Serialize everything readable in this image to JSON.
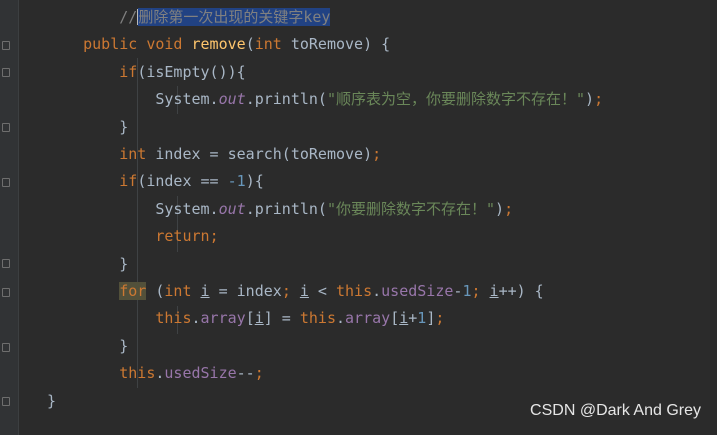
{
  "editor": {
    "lines": [
      {
        "indent": "        ",
        "parts": [
          {
            "t": "//",
            "c": "cmt"
          },
          {
            "t": "删除第一次出现的关键字key",
            "c": "cmt sel",
            "caret": true
          }
        ]
      },
      {
        "indent": "    ",
        "parts": [
          {
            "t": "public ",
            "c": "k"
          },
          {
            "t": "void ",
            "c": "k"
          },
          {
            "t": "remove",
            "c": "fn"
          },
          {
            "t": "("
          },
          {
            "t": "int ",
            "c": "k"
          },
          {
            "t": "toRemove) {"
          }
        ]
      },
      {
        "indent": "        ",
        "parts": [
          {
            "t": "if",
            "c": "k"
          },
          {
            "t": "(isEmpty()){"
          }
        ]
      },
      {
        "indent": "            ",
        "parts": [
          {
            "t": "System."
          },
          {
            "t": "out",
            "c": "fldi"
          },
          {
            "t": ".println("
          },
          {
            "t": "\"顺序表为空，你要删除数字不存在！\"",
            "c": "str"
          },
          {
            "t": ")"
          },
          {
            "t": ";",
            "c": "k"
          }
        ]
      },
      {
        "indent": "        ",
        "parts": [
          {
            "t": "}"
          }
        ]
      },
      {
        "indent": "        ",
        "parts": [
          {
            "t": "int ",
            "c": "k"
          },
          {
            "t": "index = search(toRemove)"
          },
          {
            "t": ";",
            "c": "k"
          }
        ]
      },
      {
        "indent": "        ",
        "parts": [
          {
            "t": "if",
            "c": "k"
          },
          {
            "t": "(index == "
          },
          {
            "t": "-1",
            "c": "num"
          },
          {
            "t": "){"
          }
        ]
      },
      {
        "indent": "            ",
        "parts": [
          {
            "t": "System."
          },
          {
            "t": "out",
            "c": "fldi"
          },
          {
            "t": ".println("
          },
          {
            "t": "\"你要删除数字不存在！\"",
            "c": "str"
          },
          {
            "t": ")"
          },
          {
            "t": ";",
            "c": "k"
          }
        ]
      },
      {
        "indent": "            ",
        "parts": [
          {
            "t": "return",
            "c": "k"
          },
          {
            "t": ";",
            "c": "k"
          }
        ]
      },
      {
        "indent": "        ",
        "parts": [
          {
            "t": "}"
          }
        ]
      },
      {
        "indent": "        ",
        "parts": [
          {
            "t": "for",
            "c": "k hl"
          },
          {
            "t": " ("
          },
          {
            "t": "int ",
            "c": "k"
          },
          {
            "t": "i",
            "c": "u"
          },
          {
            "t": " = index"
          },
          {
            "t": "; ",
            "c": "k"
          },
          {
            "t": "i",
            "c": "u"
          },
          {
            "t": " < "
          },
          {
            "t": "this",
            "c": "k"
          },
          {
            "t": "."
          },
          {
            "t": "usedSize",
            "c": "fld"
          },
          {
            "t": "-"
          },
          {
            "t": "1",
            "c": "num"
          },
          {
            "t": "; ",
            "c": "k"
          },
          {
            "t": "i",
            "c": "u"
          },
          {
            "t": "++) {"
          }
        ]
      },
      {
        "indent": "            ",
        "parts": [
          {
            "t": "this",
            "c": "k"
          },
          {
            "t": "."
          },
          {
            "t": "array",
            "c": "fld"
          },
          {
            "t": "["
          },
          {
            "t": "i",
            "c": "u"
          },
          {
            "t": "] = "
          },
          {
            "t": "this",
            "c": "k"
          },
          {
            "t": "."
          },
          {
            "t": "array",
            "c": "fld"
          },
          {
            "t": "["
          },
          {
            "t": "i",
            "c": "u"
          },
          {
            "t": "+"
          },
          {
            "t": "1",
            "c": "num"
          },
          {
            "t": "]"
          },
          {
            "t": ";",
            "c": "k"
          }
        ]
      },
      {
        "indent": "        ",
        "parts": [
          {
            "t": "}"
          }
        ]
      },
      {
        "indent": "        ",
        "parts": [
          {
            "t": "this",
            "c": "k"
          },
          {
            "t": "."
          },
          {
            "t": "usedSize",
            "c": "fld"
          },
          {
            "t": "--"
          },
          {
            "t": ";",
            "c": "k"
          }
        ]
      },
      {
        "indent": "",
        "parts": [
          {
            "t": "}"
          }
        ]
      }
    ]
  },
  "watermark": "CSDN @Dark And Grey"
}
